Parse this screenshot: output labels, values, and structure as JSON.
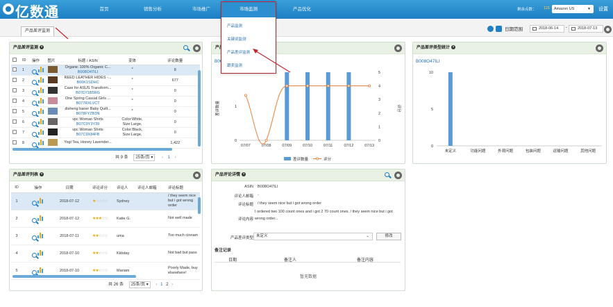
{
  "nav": {
    "logo": "亿数通",
    "items": [
      "首页",
      "销售分析",
      "市场推广",
      "市场监测",
      "产品优化"
    ],
    "credits_label": "剩余点数：",
    "credits": "115",
    "marketplace": "Amazon US",
    "settings": "设置"
  },
  "dropdown": {
    "items": [
      "产品监测",
      "关键词监测",
      "产品差评监测",
      "跟卖监测"
    ]
  },
  "tabs": {
    "active": "产品差评监测"
  },
  "date": {
    "label": "日期范围",
    "from": "2018-06-14",
    "to": "2018-07-13"
  },
  "monitor": {
    "title": "产品差评监测",
    "cols": [
      "ID",
      "操作",
      "图片",
      "标题 / ASIN",
      "变体",
      "评论数量"
    ],
    "rows": [
      {
        "id": "1",
        "title": "Organic 100% Organic C...",
        "asin": "B008O47ILI",
        "var": "*",
        "count": "8"
      },
      {
        "id": "2",
        "title": "REED LEATHER HIDES -...",
        "asin": "B00K1SDHC",
        "var": "*",
        "count": "677"
      },
      {
        "id": "3",
        "title": "Case for ASUS Transform...",
        "asin": "B07D71B5RG",
        "var": "*",
        "count": "0"
      },
      {
        "id": "4",
        "title": "One Spring Casual Girls ...",
        "asin": "B077RXLVCT",
        "var": "*",
        "count": "0"
      },
      {
        "id": "5",
        "title": "disheng baoer Baby Quilt...",
        "asin": "B078FYZB3N",
        "var": "*",
        "count": "0"
      },
      {
        "id": "6",
        "title": "vpc Woman Shirts",
        "asin": "B07C9Y3Y39",
        "var": "Color:White, Size:Large,",
        "count": "0"
      },
      {
        "id": "7",
        "title": "vpc Woman Shirts",
        "asin": "B07C9X84FB",
        "var": "Color:Black, Size:Large,",
        "count": "0"
      },
      {
        "id": "8",
        "title": "Yogi Tea, Honey Lavender...",
        "asin": "",
        "var": "",
        "count": "1,422"
      }
    ],
    "total": "共 9 条",
    "pagesize": "25条/页",
    "page": "1"
  },
  "trend": {
    "title": "产品差评",
    "asin": "B008O47ILI",
    "ylabel_left": "差评数量",
    "ylabel_right": "评分",
    "legend_bar": "差评数量",
    "legend_line": "评分"
  },
  "stats": {
    "title": "产品差评类型统计",
    "asin": "B008O47ILI"
  },
  "reviews": {
    "title": "产品差评列表",
    "cols": [
      "ID",
      "操作",
      "日期",
      "评论评分",
      "评论人",
      "评论人邮箱",
      "评论标题"
    ],
    "rows": [
      {
        "id": "1",
        "date": "2018-07-12",
        "stars": 1,
        "user": "Sydney",
        "title": "/ they seem nice but i got wrong order"
      },
      {
        "id": "2",
        "date": "2018-07-12",
        "stars": 3,
        "user": "Katie G.",
        "title": "Not well made"
      },
      {
        "id": "3",
        "date": "2018-07-11",
        "stars": 2,
        "user": "uma",
        "title": "Too much cinnam"
      },
      {
        "id": "4",
        "date": "2018-07-10",
        "stars": 2,
        "user": "Kkbday",
        "title": "Not bad but pass"
      },
      {
        "id": "5",
        "date": "2018-07-10",
        "stars": 2,
        "user": "Mariam",
        "title": "Poorly Made, buy elsewhere!"
      }
    ],
    "total": "共 26 条",
    "pagesize": "25条/页",
    "pages": [
      "1",
      "2"
    ]
  },
  "detail": {
    "title": "产品评论详情",
    "asin_label": "ASIN",
    "asin": "B008O47ILI",
    "email_label": "评论人邮箱",
    "email": "-",
    "rtitle_label": "评论标题",
    "rtitle": "/ they seem nice but i got wrong order",
    "content_label": "评论内容",
    "content": "I ordered two 100 count ones and i got 2 70 count ones. / they seem nice but i got wrong order...",
    "type_label": "产品差评类型",
    "type": "未定义",
    "modify": "修改",
    "notes_title": "备注记录",
    "notes_cols": [
      "日期",
      "备注人",
      "备注内容"
    ],
    "empty": "暂无数据"
  },
  "chart_data": [
    {
      "type": "bar+line",
      "categories": [
        "07/07",
        "07/08",
        "07/09",
        "07/10",
        "07/11",
        "07/12",
        "07/13"
      ],
      "series": [
        {
          "name": "差评数量",
          "type": "bar",
          "values": [
            0,
            0,
            2,
            2,
            2,
            2,
            0
          ]
        },
        {
          "name": "评分",
          "type": "line",
          "values": [
            3.3,
            0,
            4,
            4,
            4,
            4,
            4
          ]
        }
      ],
      "ylim_left": [
        0,
        2
      ],
      "ylim_right": [
        0,
        5
      ],
      "ylabel": "差评数量",
      "y2label": "评分"
    },
    {
      "type": "bar",
      "categories": [
        "未定义",
        "功能问题",
        "外观问题",
        "包装问题",
        "运输问题",
        "其他问题"
      ],
      "values": [
        10,
        0,
        0,
        0,
        0,
        0
      ],
      "ylim": [
        0,
        10
      ]
    }
  ],
  "colors": {
    "nav": "#1c7fc2",
    "bar": "#5b9bd5",
    "line": "#ed7d31",
    "accent": "#c0262d"
  }
}
